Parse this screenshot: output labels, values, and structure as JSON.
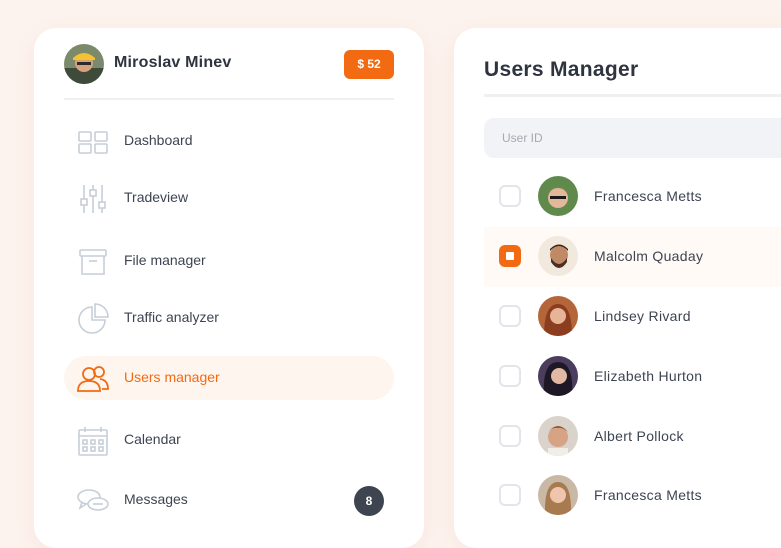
{
  "header": {
    "user_name": "Miroslav Minev",
    "balance": "$ 52"
  },
  "sidebar": {
    "items": [
      {
        "label": "Dashboard",
        "icon": "dashboard-icon",
        "active": false
      },
      {
        "label": "Tradeview",
        "icon": "sliders-icon",
        "active": false
      },
      {
        "label": "File manager",
        "icon": "archive-box-icon",
        "active": false
      },
      {
        "label": "Traffic analyzer",
        "icon": "pie-chart-icon",
        "active": false
      },
      {
        "label": "Users manager",
        "icon": "users-icon",
        "active": true
      },
      {
        "label": "Calendar",
        "icon": "calendar-icon",
        "active": false
      },
      {
        "label": "Messages",
        "icon": "chat-bubbles-icon",
        "active": false,
        "badge": "8"
      }
    ]
  },
  "users_panel": {
    "title": "Users Manager",
    "search_placeholder": "User ID",
    "users": [
      {
        "name": "Francesca Metts",
        "checked": false
      },
      {
        "name": "Malcolm Quaday",
        "checked": true
      },
      {
        "name": "Lindsey Rivard",
        "checked": false
      },
      {
        "name": "Elizabeth Hurton",
        "checked": false
      },
      {
        "name": "Albert Pollock",
        "checked": false
      },
      {
        "name": "Francesca Metts",
        "checked": false
      }
    ]
  },
  "colors": {
    "accent": "#f26a11",
    "background": "#fdf3ee",
    "text": "#3d4452",
    "icon": "#c7ced8",
    "badge": "#3f4550"
  }
}
